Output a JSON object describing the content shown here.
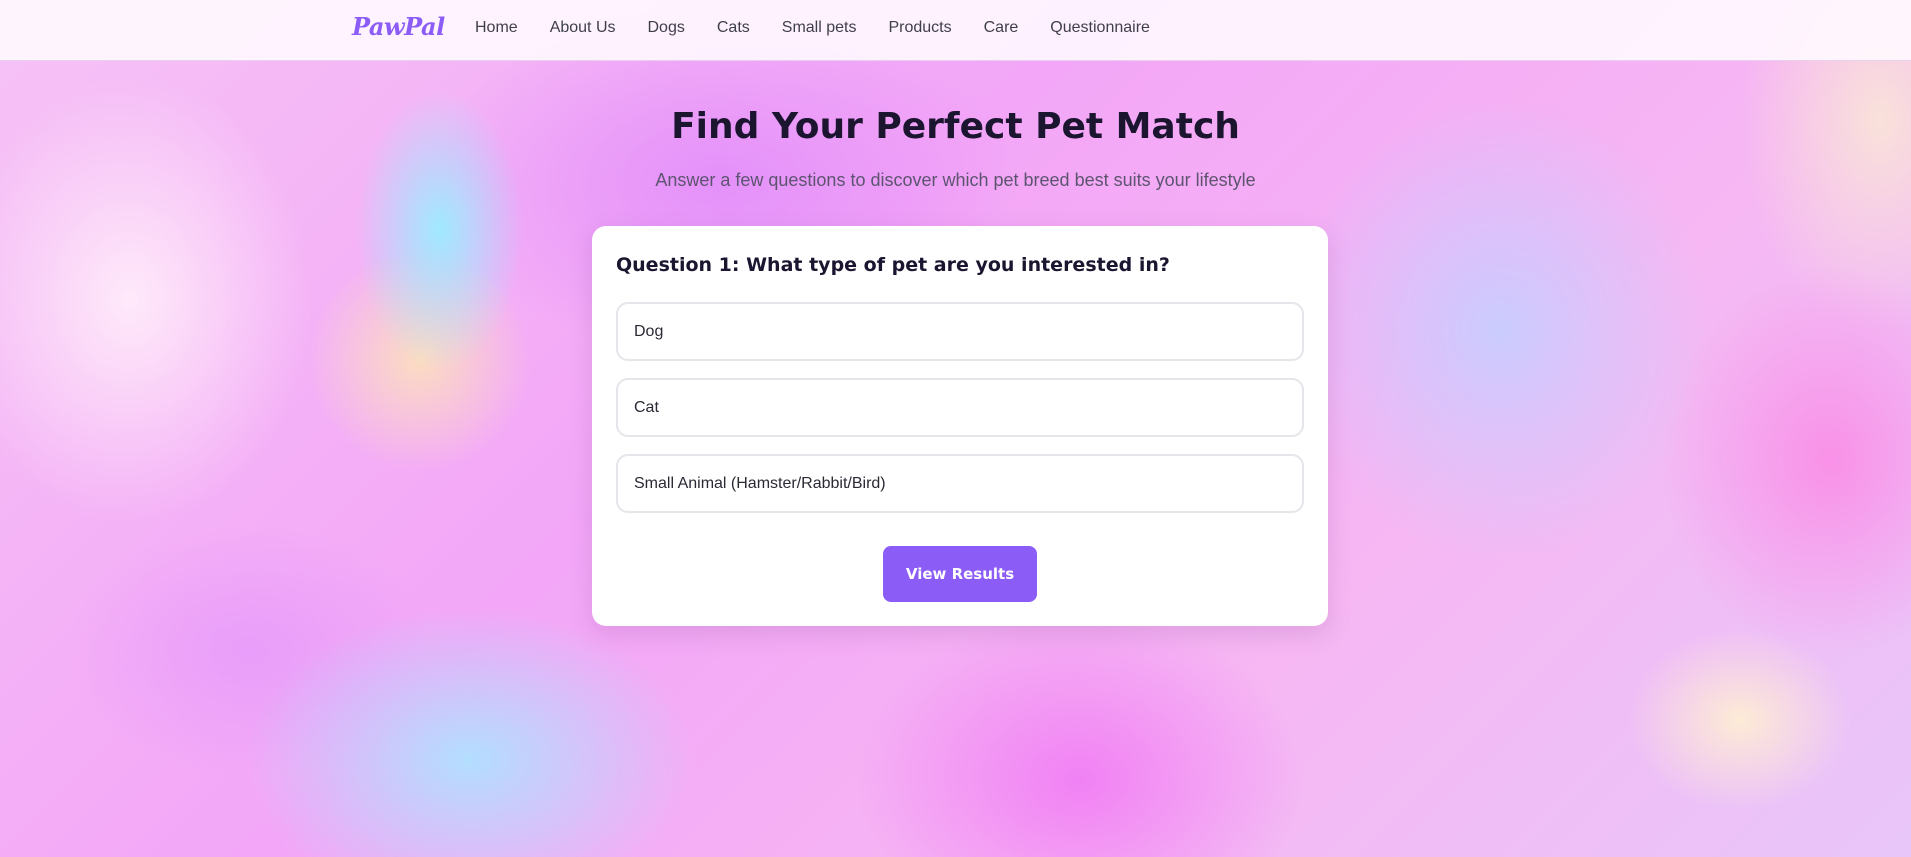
{
  "brand": {
    "logo_text": "PawPal",
    "accent_color": "#8b5cf6"
  },
  "nav": {
    "items": [
      {
        "label": "Home"
      },
      {
        "label": "About Us"
      },
      {
        "label": "Dogs"
      },
      {
        "label": "Cats"
      },
      {
        "label": "Small pets"
      },
      {
        "label": "Products"
      },
      {
        "label": "Care"
      },
      {
        "label": "Questionnaire"
      }
    ]
  },
  "hero": {
    "title": "Find Your Perfect Pet Match",
    "subtitle": "Answer a few questions to discover which pet breed best suits your lifestyle"
  },
  "quiz": {
    "question": "Question 1: What type of pet are you interested in?",
    "options": [
      {
        "label": "Dog"
      },
      {
        "label": "Cat"
      },
      {
        "label": "Small Animal (Hamster/Rabbit/Bird)"
      }
    ],
    "submit_label": "View Results"
  }
}
